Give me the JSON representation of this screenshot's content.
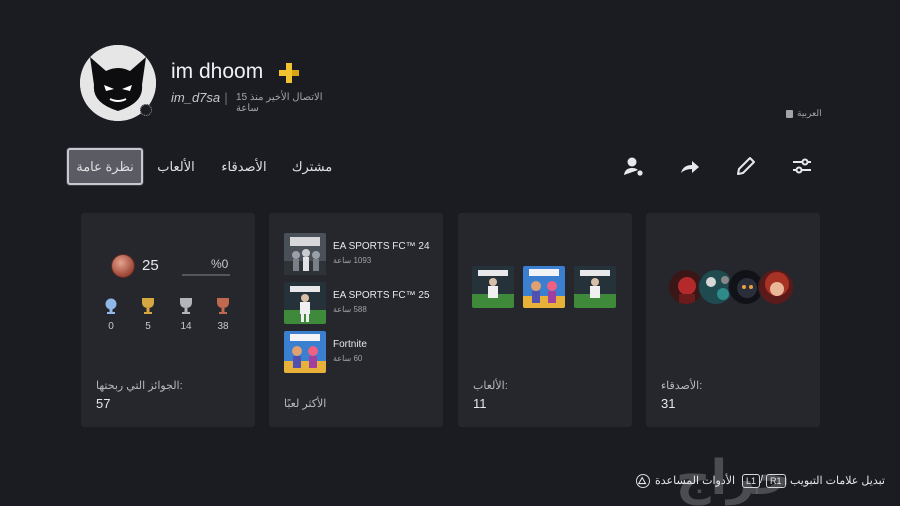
{
  "profile": {
    "display_name": "im dhoom",
    "online_id": "im_d7sa",
    "separator": "|",
    "last_online": "الاتصال الأخير منذ 15 ساعة",
    "language": "العربية"
  },
  "tabs": [
    {
      "label": "نظرة عامة",
      "active": true
    },
    {
      "label": "الألعاب"
    },
    {
      "label": "الأصدقاء"
    },
    {
      "label": "مشترك"
    }
  ],
  "actions": {
    "icons": [
      "add-friend-icon",
      "share-icon",
      "edit-icon",
      "settings-sliders-icon"
    ]
  },
  "trophies_card": {
    "level": "25",
    "progress_text": "%0",
    "progress": 0,
    "counts": [
      {
        "type": "platinum",
        "count": "0"
      },
      {
        "type": "gold",
        "count": "5"
      },
      {
        "type": "silver",
        "count": "14"
      },
      {
        "type": "bronze",
        "count": "38"
      }
    ],
    "label": "الجوائز التي ربحتها:",
    "total": "57"
  },
  "most_played_card": {
    "games": [
      {
        "title": "EA SPORTS FC™ 24",
        "hours": "1093 ساعة"
      },
      {
        "title": "EA SPORTS FC™ 25",
        "hours": "588 ساعة"
      },
      {
        "title": "Fortnite",
        "hours": "60 ساعة"
      }
    ],
    "label": "الأكثر لعبًا"
  },
  "games_card": {
    "label": "الألعاب:",
    "count": "11"
  },
  "friends_card": {
    "label": "الأصدقاء:",
    "count": "31"
  },
  "footer": {
    "switch_tabs": "تبديل علامات التبويب",
    "r1": "R1",
    "slash": "/",
    "l1": "L1",
    "tools": "الأدوات المساعدة"
  },
  "watermark": "حراج",
  "colors": {
    "background": "#1b1c21",
    "card": "#26272d",
    "plus_gold": "#f2c230",
    "active_tab": "#5a5b63"
  }
}
